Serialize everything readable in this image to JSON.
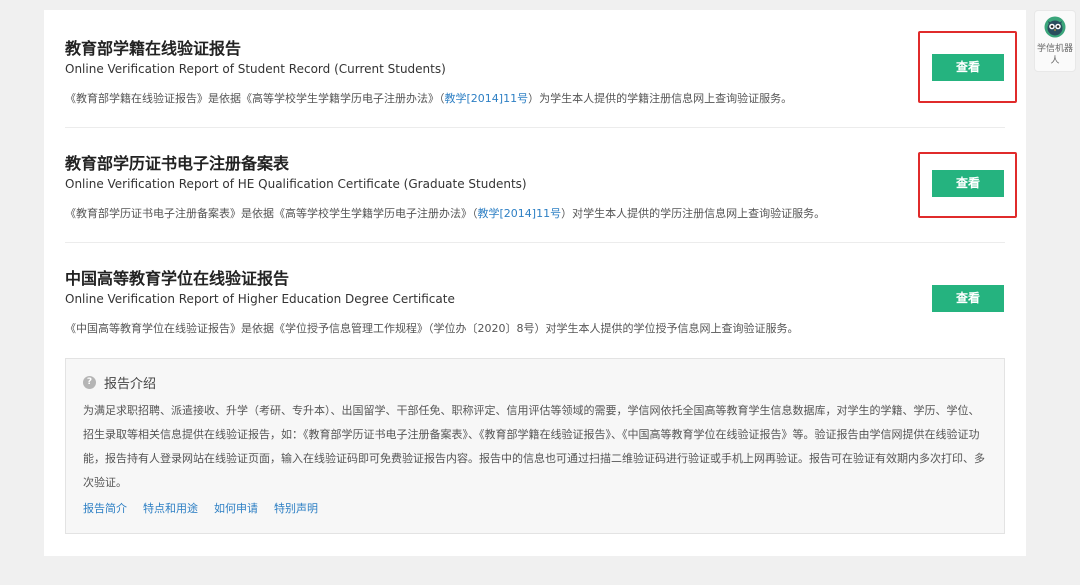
{
  "reports": [
    {
      "title": "教育部学籍在线验证报告",
      "subtitle": "Online Verification Report of Student Record (Current Students)",
      "desc_pre": "《教育部学籍在线验证报告》是依据《高等学校学生学籍学历电子注册办法》（",
      "desc_link": "教学[2014]11号",
      "desc_post": "）为学生本人提供的学籍注册信息网上查询验证服务。",
      "button": "查看"
    },
    {
      "title": "教育部学历证书电子注册备案表",
      "subtitle": "Online Verification Report of HE Qualification Certificate (Graduate Students)",
      "desc_pre": "《教育部学历证书电子注册备案表》是依据《高等学校学生学籍学历电子注册办法》（",
      "desc_link": "教学[2014]11号",
      "desc_post": "）对学生本人提供的学历注册信息网上查询验证服务。",
      "button": "查看"
    },
    {
      "title": "中国高等教育学位在线验证报告",
      "subtitle": "Online Verification Report of Higher Education Degree Certificate",
      "desc_pre": "《中国高等教育学位在线验证报告》是依据《学位授予信息管理工作规程》（学位办〔2020〕8号）对学生本人提供的学位授予信息网上查询验证服务。",
      "desc_link": "",
      "desc_post": "",
      "button": "查看"
    }
  ],
  "intro": {
    "title": "报告介绍",
    "body": "为满足求职招聘、派遣接收、升学（考研、专升本）、出国留学、干部任免、职称评定、信用评估等领域的需要，学信网依托全国高等教育学生信息数据库，对学生的学籍、学历、学位、招生录取等相关信息提供在线验证报告，如：《教育部学历证书电子注册备案表》、《教育部学籍在线验证报告》、《中国高等教育学位在线验证报告》等。验证报告由学信网提供在线验证功能，报告持有人登录网站在线验证页面，输入在线验证码即可免费验证报告内容。报告中的信息也可通过扫描二维验证码进行验证或手机上网再验证。报告可在验证有效期内多次打印、多次验证。",
    "links": [
      "报告简介",
      "特点和用途",
      "如何申请",
      "特别声明"
    ]
  },
  "robot": {
    "label": "学信机器人",
    "icon": "owl-robot-icon"
  },
  "colors": {
    "accent": "#25b37f",
    "link": "#2d7fc4",
    "highlight": "#e02b2b"
  }
}
